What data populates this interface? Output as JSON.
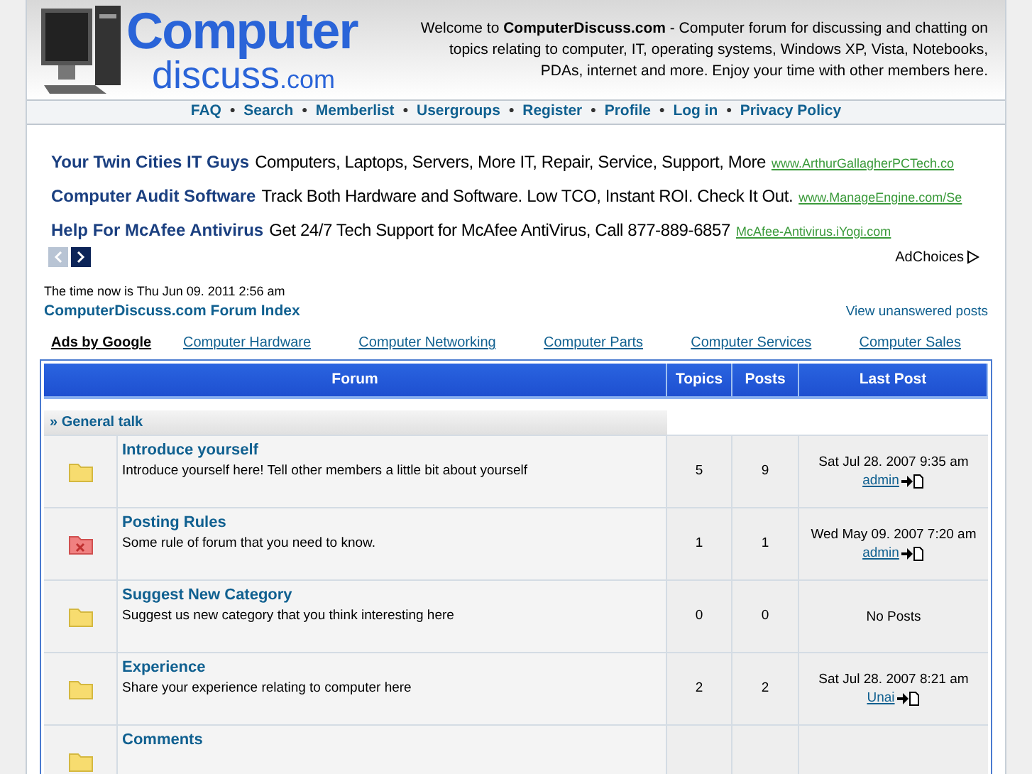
{
  "logo": {
    "line1": "Computer",
    "line2": "discuss",
    "suffix": ".com"
  },
  "welcome": "Welcome to **ComputerDiscuss.com** - Computer forum for discussing and chatting on topics relating to computer, IT, operating systems, Windows XP, Vista, Notebooks, PDAs, internet and more. Enjoy your time with other members here.",
  "nav": [
    "FAQ",
    "Search",
    "Memberlist",
    "Usergroups",
    "Register",
    "Profile",
    "Log in",
    "Privacy Policy"
  ],
  "nav_separator": "•",
  "ads": [
    {
      "title": "Your Twin Cities IT Guys",
      "text": "Computers, Laptops, Servers, More IT, Repair, Service, Support, More",
      "url": "www.ArthurGallagherPCTech.co"
    },
    {
      "title": "Computer Audit Software",
      "text": "Track Both Hardware and Software. Low TCO, Instant ROI. Check It Out.",
      "url": "www.ManageEngine.com/Se"
    },
    {
      "title": "Help For McAfee Antivirus",
      "text": "Get 24/7 Tech Support for McAfee AntiVirus, Call 877-889-6857",
      "url": "McAfee-Antivirus.iYogi.com"
    }
  ],
  "ad_pager": {
    "prev_disabled": true,
    "next_disabled": false
  },
  "adchoices": "AdChoices",
  "time": "The time now is Thu Jun 09. 2011 2:56 am",
  "index_link": "ComputerDiscuss.com Forum Index",
  "unanswered_link": "View unanswered posts",
  "ad_links_title": "Ads by Google",
  "ad_links": [
    "Computer Hardware",
    "Computer Networking",
    "Computer Parts",
    "Computer Services",
    "Computer Sales"
  ],
  "table": {
    "columns": [
      "Forum",
      "Topics",
      "Posts",
      "Last Post"
    ],
    "category": "» General talk",
    "rows": [
      {
        "title": "Introduce yourself",
        "description": "Introduce yourself here! Tell other members a little bit about yourself",
        "locked": false,
        "topics": "5",
        "posts": "9",
        "last_post": {
          "kind": "post",
          "date": "Sat Jul 28. 2007 9:35 am",
          "user": "admin"
        }
      },
      {
        "title": "Posting Rules",
        "description": "Some rule of forum that you need to know.",
        "locked": true,
        "topics": "1",
        "posts": "1",
        "last_post": {
          "kind": "post",
          "date": "Wed May 09. 2007 7:20 am",
          "user": "admin"
        }
      },
      {
        "title": "Suggest New Category",
        "description": "Suggest us new category that you think interesting here",
        "locked": false,
        "topics": "0",
        "posts": "0",
        "last_post": {
          "kind": "none",
          "text": "No Posts"
        }
      },
      {
        "title": "Experience",
        "description": "Share your experience relating to computer here",
        "locked": false,
        "topics": "2",
        "posts": "2",
        "last_post": {
          "kind": "post",
          "date": "Sat Jul 28. 2007 8:21 am",
          "user": "Unai"
        }
      },
      {
        "title": "Comments",
        "locked": false
      }
    ]
  }
}
